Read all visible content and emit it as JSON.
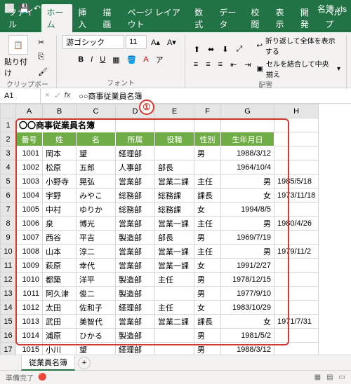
{
  "titlebar": {
    "doc_name": "名簿.xls"
  },
  "ribbon_tabs": [
    "ファイル",
    "ホーム",
    "挿入",
    "描画",
    "ページ レイアウト",
    "数式",
    "データ",
    "校閲",
    "表示",
    "開発",
    "ヘルプ"
  ],
  "active_ribbon_tab": "ホーム",
  "ribbon": {
    "paste_label": "貼り付け",
    "clipboard_group": "クリップボード",
    "font_name": "游ゴシック",
    "font_size": "11",
    "font_group": "フォント",
    "wrap_text": "折り返して全体を表示する",
    "merge_center": "セルを結合して中央揃え",
    "align_group": "配置"
  },
  "namebox": {
    "ref": "A1",
    "formula": "○○商事従業員名簿"
  },
  "callout": "①",
  "sheet": {
    "title": "〇〇商事従業員名簿",
    "cols": [
      "A",
      "B",
      "C",
      "D",
      "E",
      "F",
      "G",
      "H"
    ],
    "headers": [
      "番号",
      "姓",
      "名",
      "所属",
      "役職",
      "性別",
      "生年月日"
    ],
    "rows": [
      {
        "n": "1001",
        "ln": "岡本",
        "fn": "望",
        "d": "経理部",
        "r": "",
        "s": "男",
        "b": "1988/3/12"
      },
      {
        "n": "1002",
        "ln": "松原",
        "fn": "五郎",
        "d": "人事部",
        "r": "部長",
        "s": "",
        "b": "1964/10/4"
      },
      {
        "n": "1003",
        "ln": "小野寺",
        "fn": "晃弘",
        "d": "営業部",
        "r": "営業二課",
        "x": "主任",
        "s": "男",
        "b": "1985/5/18"
      },
      {
        "n": "1004",
        "ln": "宇野",
        "fn": "みやこ",
        "d": "総務部",
        "r": "総務課",
        "x": "課長",
        "s": "女",
        "b": "1973/11/18"
      },
      {
        "n": "1005",
        "ln": "中村",
        "fn": "ゆりか",
        "d": "総務部",
        "r": "総務課",
        "x": "",
        "s": "女",
        "b": "1994/8/5"
      },
      {
        "n": "1006",
        "ln": "泉",
        "fn": "博光",
        "d": "営業部",
        "r": "営業一課",
        "x": "主任",
        "s": "男",
        "b": "1980/4/26"
      },
      {
        "n": "1007",
        "ln": "西谷",
        "fn": "平吉",
        "d": "製造部",
        "r": "",
        "x": "部長",
        "s": "男",
        "b": "1969/7/19"
      },
      {
        "n": "1008",
        "ln": "山本",
        "fn": "淳二",
        "d": "営業部",
        "r": "営業一課",
        "x": "主任",
        "s": "男",
        "b": "1979/11/2"
      },
      {
        "n": "1009",
        "ln": "萩原",
        "fn": "幸代",
        "d": "営業部",
        "r": "営業一課",
        "x": "",
        "s": "女",
        "b": "1991/2/27"
      },
      {
        "n": "1010",
        "ln": "都築",
        "fn": "洋平",
        "d": "製造部",
        "r": "",
        "x": "主任",
        "s": "男",
        "b": "1978/12/15"
      },
      {
        "n": "1011",
        "ln": "阿久津",
        "fn": "俊二",
        "d": "製造部",
        "r": "",
        "x": "",
        "s": "男",
        "b": "1977/9/10"
      },
      {
        "n": "1012",
        "ln": "太田",
        "fn": "佐和子",
        "d": "経理部",
        "r": "",
        "x": "主任",
        "s": "女",
        "b": "1983/10/29"
      },
      {
        "n": "1013",
        "ln": "武田",
        "fn": "美智代",
        "d": "営業部",
        "r": "営業二課",
        "x": "課長",
        "s": "女",
        "b": "1971/7/31"
      },
      {
        "n": "1014",
        "ln": "浦原",
        "fn": "ひかる",
        "d": "製造部",
        "r": "",
        "x": "",
        "s": "男",
        "b": "1981/5/2"
      },
      {
        "n": "1015",
        "ln": "小川",
        "fn": "望",
        "d": "経理部",
        "r": "",
        "x": "",
        "s": "男",
        "b": "1988/3/12"
      }
    ]
  },
  "sheet_tab": "従業員名簿",
  "status": {
    "ready": "準備完了",
    "rec": "🔴"
  }
}
